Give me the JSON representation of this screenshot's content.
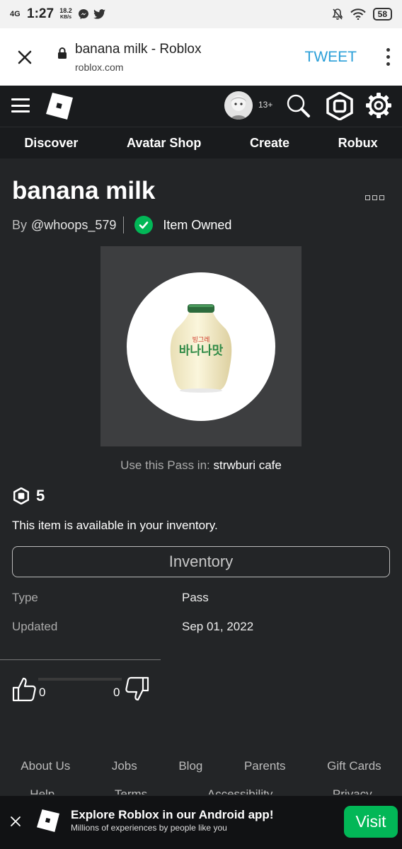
{
  "statusbar": {
    "network": "4G",
    "time": "1:27",
    "speed_value": "18.2",
    "speed_unit": "KB/s",
    "battery": "58",
    "icons": [
      "messenger-icon",
      "twitter-icon",
      "mute-icon",
      "wifi-icon",
      "battery-icon"
    ]
  },
  "browser": {
    "title": "banana milk - Roblox",
    "url": "roblox.com",
    "tweet_label": "TWEET"
  },
  "topbar": {
    "age_badge": "13+",
    "icons": [
      "menu-icon",
      "roblox-logo",
      "avatar",
      "search-icon",
      "robux-icon",
      "settings-gear-icon"
    ]
  },
  "nav": {
    "items": [
      "Discover",
      "Avatar Shop",
      "Create",
      "Robux"
    ]
  },
  "item": {
    "name": "banana milk",
    "by_label": "By",
    "creator": "@whoops_579",
    "owned_label": "Item Owned",
    "use_pass_label": "Use this Pass in:",
    "game_name": "strwburi cafe",
    "price": "5",
    "availability": "This item is available in your inventory.",
    "inventory_button": "Inventory",
    "details": [
      {
        "label": "Type",
        "value": "Pass"
      },
      {
        "label": "Updated",
        "value": "Sep 01, 2022"
      }
    ],
    "upvotes": "0",
    "downvotes": "0"
  },
  "footer": {
    "links": [
      "About Us",
      "Jobs",
      "Blog",
      "Parents",
      "Gift Cards"
    ],
    "links_row2": [
      "Help",
      "Terms",
      "Accessibility",
      "Privacy"
    ]
  },
  "banner": {
    "title": "Explore Roblox in our Android app!",
    "subtitle": "Millions of experiences by people like you",
    "button": "Visit"
  },
  "colors": {
    "background": "#232527",
    "topbar": "#191b1d",
    "success_green": "#02b757",
    "tweet_blue": "#2a9fd8"
  }
}
